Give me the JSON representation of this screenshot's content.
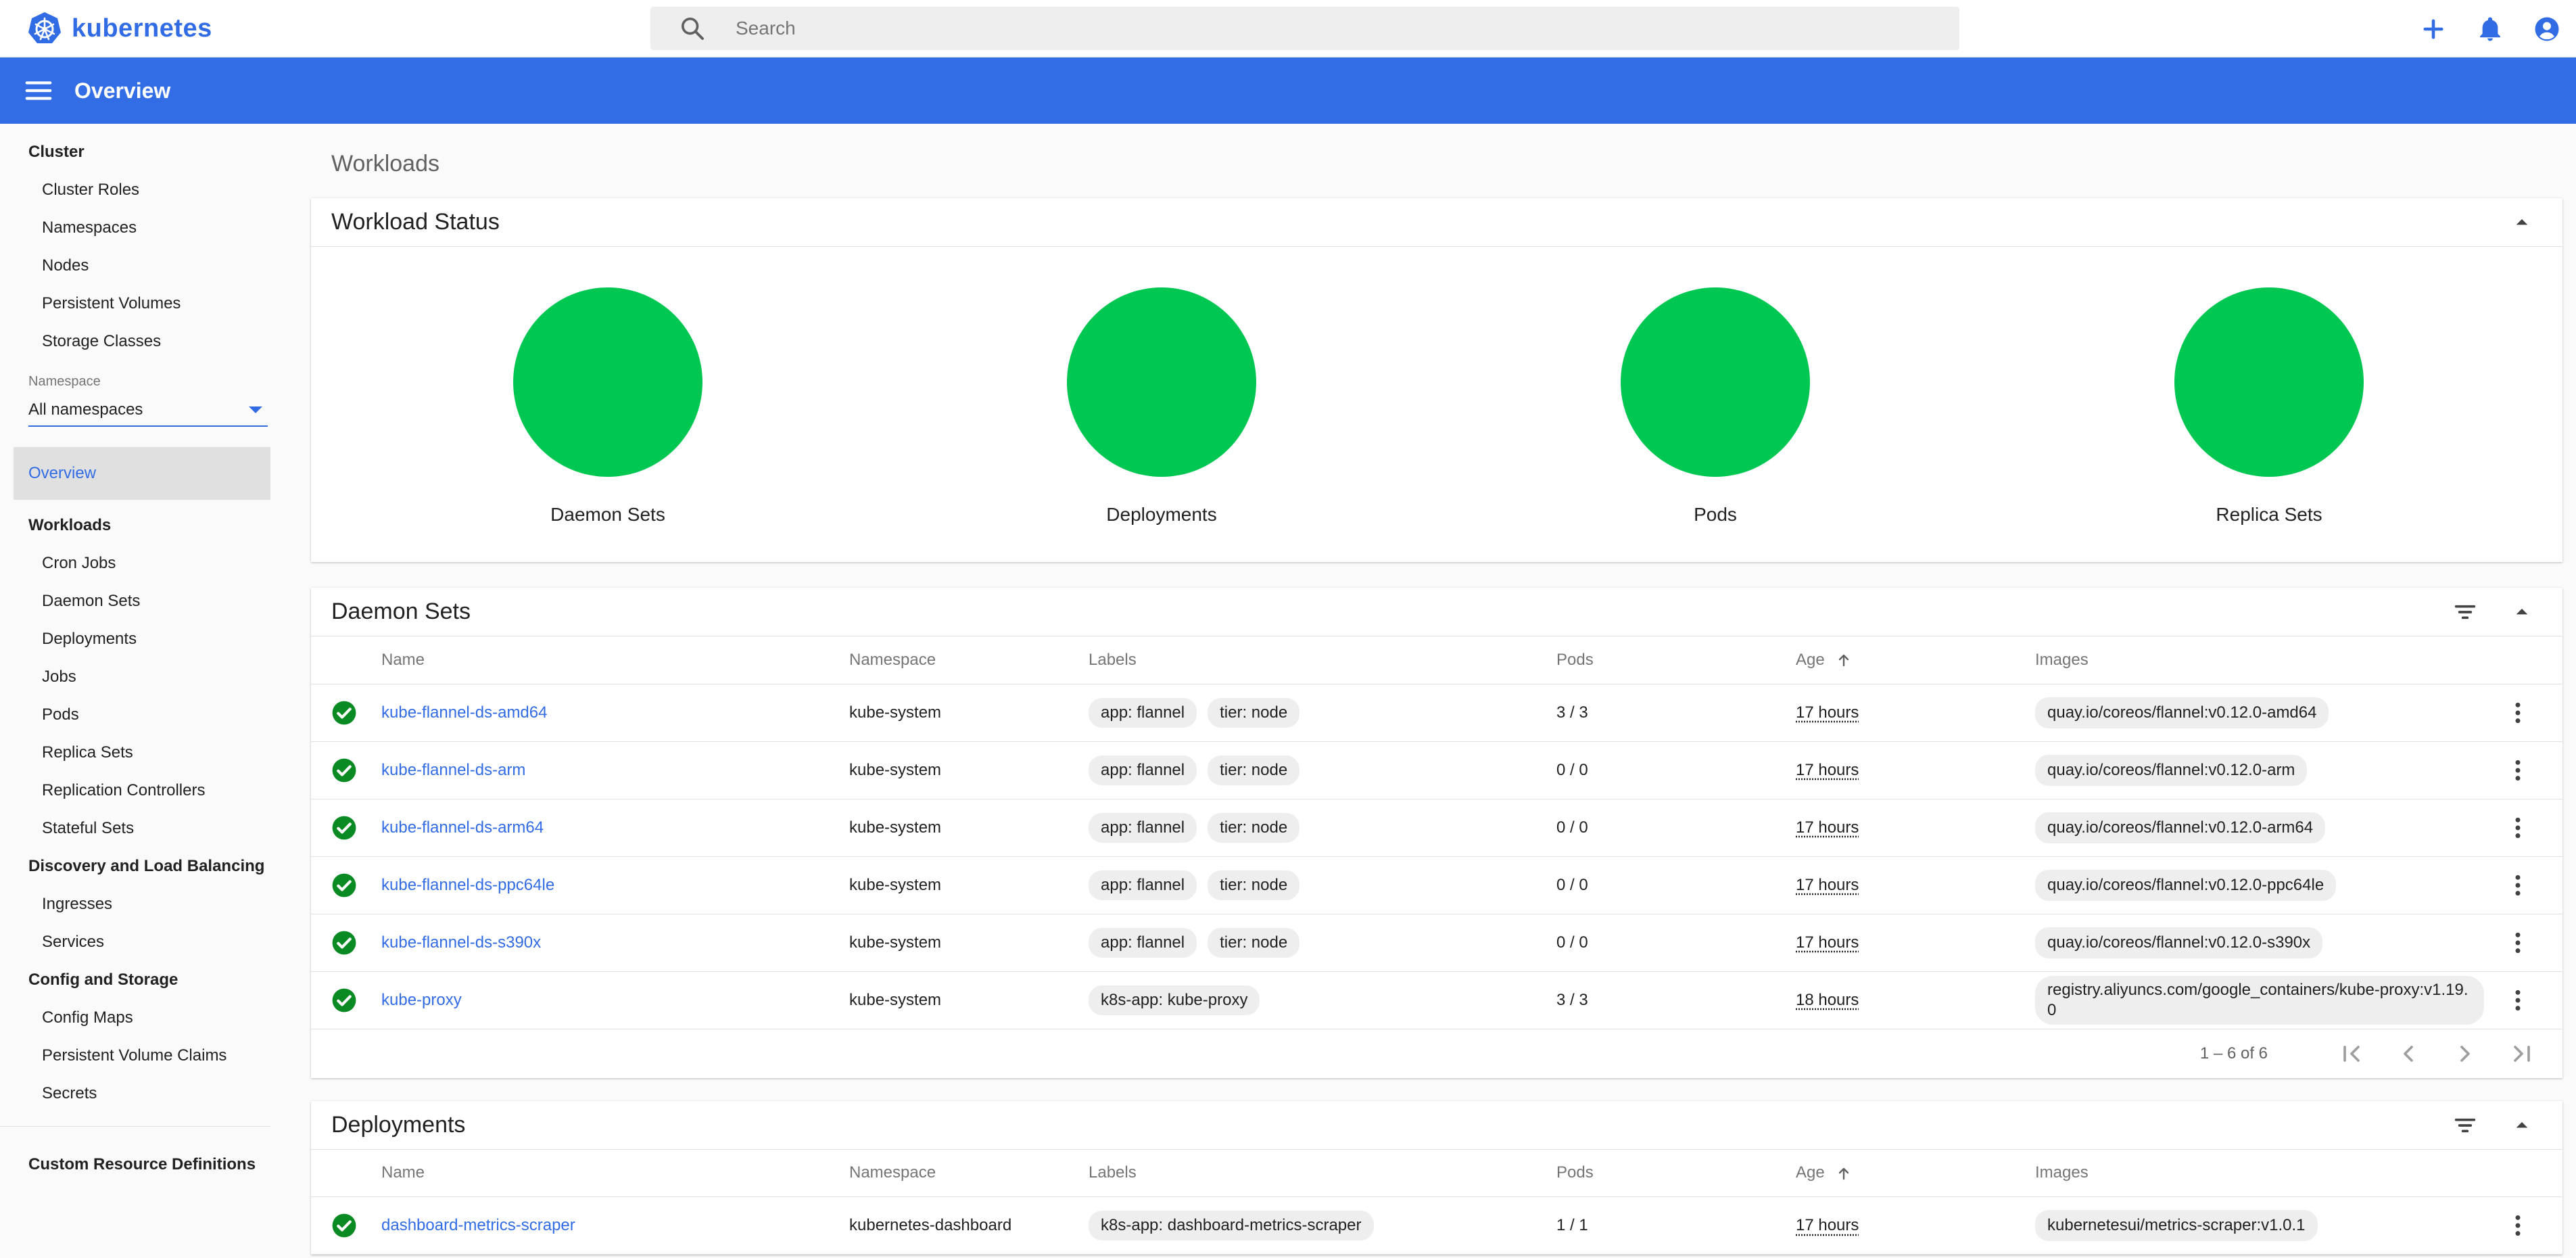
{
  "app": {
    "logo_text": "kubernetes",
    "brand_color": "#326ce5"
  },
  "search": {
    "placeholder": "Search"
  },
  "top_actions": [
    "add-icon",
    "notifications-icon",
    "account-icon"
  ],
  "appbar": {
    "title": "Overview",
    "color": "#326de6"
  },
  "sidebar": {
    "cluster_header": "Cluster",
    "cluster_items": [
      "Cluster Roles",
      "Namespaces",
      "Nodes",
      "Persistent Volumes",
      "Storage Classes"
    ],
    "namespace_label": "Namespace",
    "namespace_value": "All namespaces",
    "active_item": "Overview",
    "workloads_header": "Workloads",
    "workloads_items": [
      "Cron Jobs",
      "Daemon Sets",
      "Deployments",
      "Jobs",
      "Pods",
      "Replica Sets",
      "Replication Controllers",
      "Stateful Sets"
    ],
    "discovery_header": "Discovery and Load Balancing",
    "discovery_items": [
      "Ingresses",
      "Services"
    ],
    "config_header": "Config and Storage",
    "config_items": [
      "Config Maps",
      "Persistent Volume Claims",
      "Secrets"
    ],
    "crd_item": "Custom Resource Definitions"
  },
  "main": {
    "heading": "Workloads",
    "workload_status": {
      "title": "Workload Status",
      "status_color": "#00c752",
      "items": [
        "Daemon Sets",
        "Deployments",
        "Pods",
        "Replica Sets"
      ]
    },
    "columns": {
      "name": "Name",
      "namespace": "Namespace",
      "labels": "Labels",
      "pods": "Pods",
      "age": "Age",
      "images": "Images"
    },
    "daemon_sets": {
      "title": "Daemon Sets",
      "rows": [
        {
          "name": "kube-flannel-ds-amd64",
          "namespace": "kube-system",
          "labels": [
            "app: flannel",
            "tier: node"
          ],
          "pods": "3 / 3",
          "age": "17 hours",
          "image": "quay.io/coreos/flannel:v0.12.0-amd64"
        },
        {
          "name": "kube-flannel-ds-arm",
          "namespace": "kube-system",
          "labels": [
            "app: flannel",
            "tier: node"
          ],
          "pods": "0 / 0",
          "age": "17 hours",
          "image": "quay.io/coreos/flannel:v0.12.0-arm"
        },
        {
          "name": "kube-flannel-ds-arm64",
          "namespace": "kube-system",
          "labels": [
            "app: flannel",
            "tier: node"
          ],
          "pods": "0 / 0",
          "age": "17 hours",
          "image": "quay.io/coreos/flannel:v0.12.0-arm64"
        },
        {
          "name": "kube-flannel-ds-ppc64le",
          "namespace": "kube-system",
          "labels": [
            "app: flannel",
            "tier: node"
          ],
          "pods": "0 / 0",
          "age": "17 hours",
          "image": "quay.io/coreos/flannel:v0.12.0-ppc64le"
        },
        {
          "name": "kube-flannel-ds-s390x",
          "namespace": "kube-system",
          "labels": [
            "app: flannel",
            "tier: node"
          ],
          "pods": "0 / 0",
          "age": "17 hours",
          "image": "quay.io/coreos/flannel:v0.12.0-s390x"
        },
        {
          "name": "kube-proxy",
          "namespace": "kube-system",
          "labels": [
            "k8s-app: kube-proxy"
          ],
          "pods": "3 / 3",
          "age": "18 hours",
          "image": "registry.aliyuncs.com/google_containers/kube-proxy:v1.19.0"
        }
      ],
      "pagination": "1 – 6 of 6"
    },
    "deployments": {
      "title": "Deployments",
      "rows": [
        {
          "name": "dashboard-metrics-scraper",
          "namespace": "kubernetes-dashboard",
          "labels": [
            "k8s-app: dashboard-metrics-scraper"
          ],
          "pods": "1 / 1",
          "age": "17 hours",
          "image": "kubernetesui/metrics-scraper:v1.0.1"
        }
      ]
    },
    "ok_color": "#0a8a23"
  }
}
